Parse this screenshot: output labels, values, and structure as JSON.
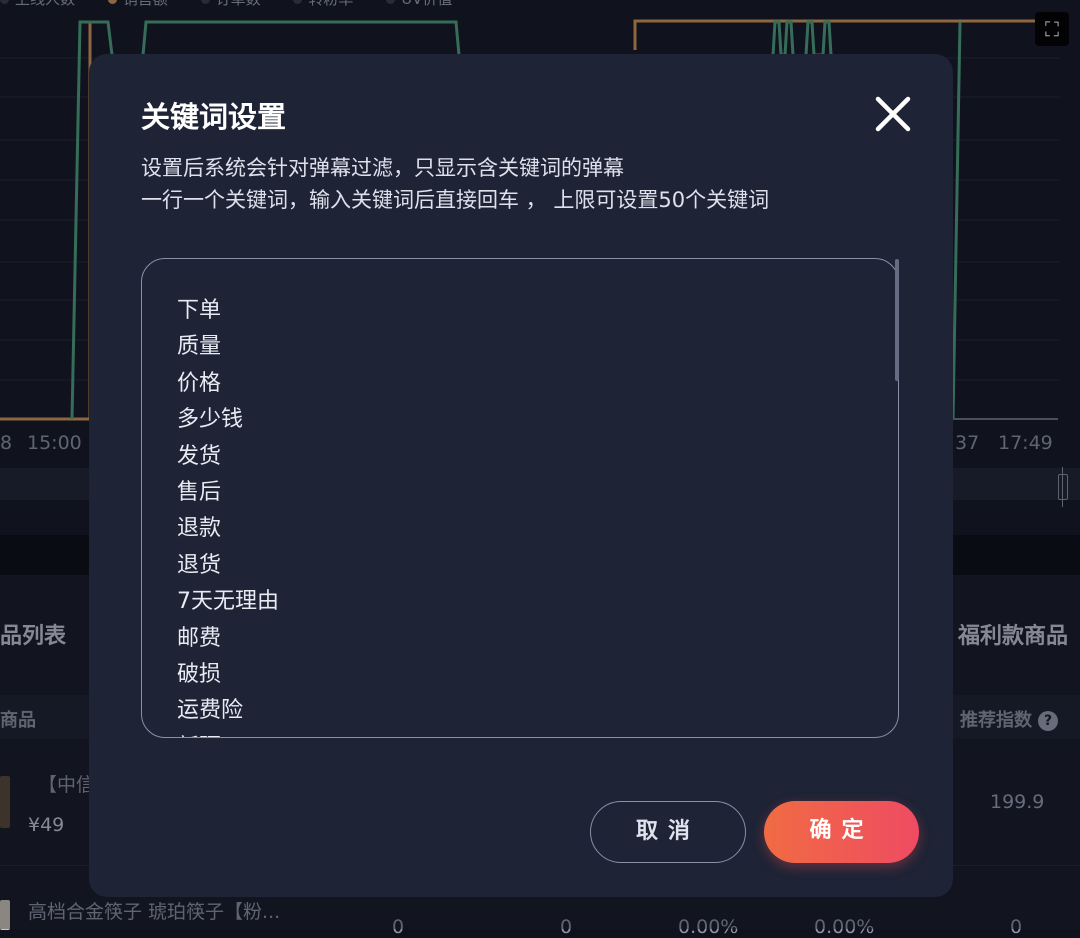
{
  "background": {
    "legend": [
      "上线人数",
      "销售额",
      "订单数",
      "转粉率",
      "UV价值"
    ],
    "x_ticks": [
      "8",
      "15:00",
      "37",
      "17:49"
    ],
    "product_section_title": "品列表",
    "welfare_section_title": "福利款商品",
    "table_headers": {
      "product": "商品",
      "recommend_index": "推荐指数"
    },
    "row1": {
      "name": "【中信",
      "price": "¥49",
      "value": "199.9"
    },
    "row2": {
      "name": "高档合金筷子 琥珀筷子【粉...",
      "c1": "0",
      "c2": "0",
      "c3": "0.00%",
      "c4": "0.00%",
      "c5": "0"
    },
    "colors": {
      "green_line": "#4fa37f",
      "orange_line": "#d69a5a"
    }
  },
  "modal": {
    "title": "关键词设置",
    "description_line1": "设置后系统会针对弹幕过滤，只显示含关键词的弹幕",
    "description_line2": "一行一个关键词，输入关键词后直接回车 ，  上限可设置50个关键词",
    "keywords": [
      "下单",
      "质量",
      "价格",
      "多少钱",
      "发货",
      "售后",
      "退款",
      "退货",
      "7天无理由",
      "邮费",
      "破损",
      "运费险",
      "新疆"
    ],
    "cancel_label": "取消",
    "confirm_label": "确定",
    "colors": {
      "modal_bg": "#1e2336",
      "confirm_gradient_start": "#f06b43",
      "confirm_gradient_end": "#ef4b62"
    }
  }
}
